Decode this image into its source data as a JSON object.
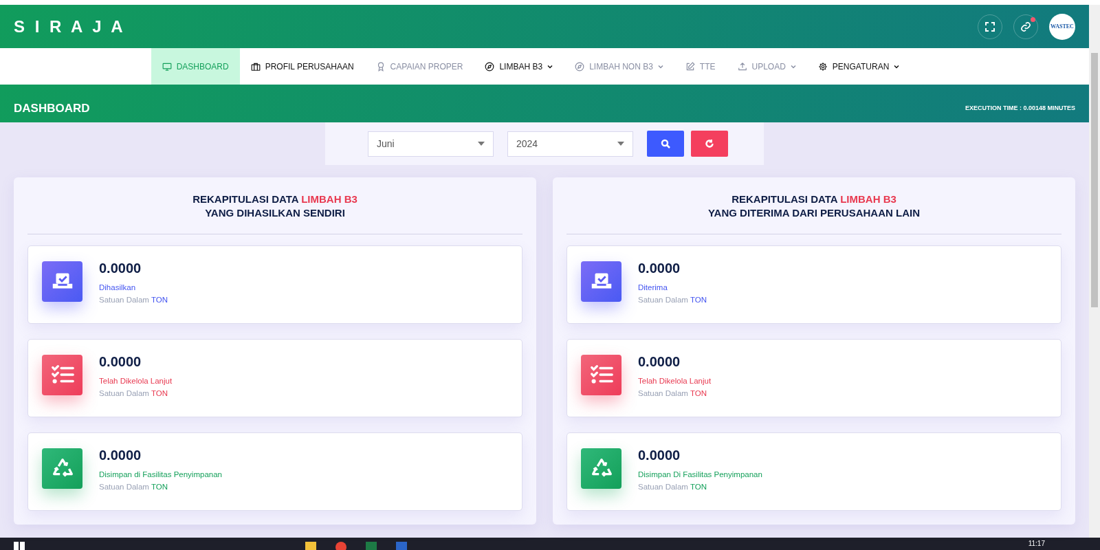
{
  "header": {
    "brand": "S I R A J A",
    "avatar_text": "WASTEC"
  },
  "nav": [
    {
      "label": "DASHBOARD",
      "kind": "monitor",
      "dropdown": false,
      "selected": true,
      "disabled": false
    },
    {
      "label": "PROFIL PERUSAHAAN",
      "kind": "briefcase",
      "dropdown": false,
      "selected": false,
      "disabled": false
    },
    {
      "label": "CAPAIAN PROPER",
      "kind": "award",
      "dropdown": false,
      "selected": false,
      "disabled": true
    },
    {
      "label": "LIMBAH B3",
      "kind": "compass",
      "dropdown": true,
      "selected": false,
      "disabled": false
    },
    {
      "label": "LIMBAH NON B3",
      "kind": "compass",
      "dropdown": true,
      "selected": false,
      "disabled": true
    },
    {
      "label": "TTE",
      "kind": "edit",
      "dropdown": false,
      "selected": false,
      "disabled": true
    },
    {
      "label": "UPLOAD",
      "kind": "upload",
      "dropdown": true,
      "selected": false,
      "disabled": true
    },
    {
      "label": "PENGATURAN",
      "kind": "gear",
      "dropdown": true,
      "selected": false,
      "disabled": false
    }
  ],
  "page": {
    "title": "DASHBOARD",
    "execution_time": "EXECUTION TIME : 0.00148 MINUTES"
  },
  "filter": {
    "month": "Juni",
    "year": "2024"
  },
  "panels": [
    {
      "title": "REKAPITULASI DATA",
      "highlight": "LIMBAH B3",
      "subtitle": "YANG DIHASILKAN SENDIRI",
      "stats": [
        {
          "kind": "blue",
          "value": "0.0000",
          "label": "Dihasilkan",
          "unit_prefix": "Satuan Dalam",
          "unit": "TON"
        },
        {
          "kind": "red",
          "value": "0.0000",
          "label": "Telah Dikelola Lanjut",
          "unit_prefix": "Satuan Dalam",
          "unit": "TON"
        },
        {
          "kind": "green",
          "value": "0.0000",
          "label": "Disimpan di Fasilitas Penyimpanan",
          "unit_prefix": "Satuan Dalam",
          "unit": "TON"
        }
      ]
    },
    {
      "title": "REKAPITULASI DATA",
      "highlight": "LIMBAH B3",
      "subtitle": "YANG DITERIMA DARI PERUSAHAAN LAIN",
      "stats": [
        {
          "kind": "blue",
          "value": "0.0000",
          "label": "Diterima",
          "unit_prefix": "Satuan Dalam",
          "unit": "TON"
        },
        {
          "kind": "red",
          "value": "0.0000",
          "label": "Telah Dikelola Lanjut",
          "unit_prefix": "Satuan Dalam",
          "unit": "TON"
        },
        {
          "kind": "green",
          "value": "0.0000",
          "label": "Disimpan Di Fasilitas Penyimpanan",
          "unit_prefix": "Satuan Dalam",
          "unit": "TON"
        }
      ]
    }
  ],
  "taskbar": {
    "clock": "11:17"
  }
}
